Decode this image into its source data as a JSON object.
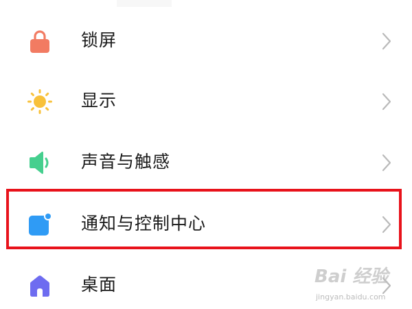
{
  "colors": {
    "lock_icon": "#f27b62",
    "display_icon": "#f8c13a",
    "sound_icon": "#45cf8e",
    "notify_icon": "#2f9bf5",
    "home_icon": "#6e6cf0",
    "chevron": "#b9b9b9",
    "highlight": "#e8121b"
  },
  "settings": {
    "items": [
      {
        "label": "锁屏",
        "icon": "lock-icon"
      },
      {
        "label": "显示",
        "icon": "sun-icon"
      },
      {
        "label": "声音与触感",
        "icon": "speaker-icon"
      },
      {
        "label": "通知与控制中心",
        "icon": "notification-icon"
      },
      {
        "label": "桌面",
        "icon": "home-icon"
      }
    ]
  },
  "watermark": {
    "logo_text": "Bai 经验",
    "sub_text": "jingyan.baidu.com"
  }
}
